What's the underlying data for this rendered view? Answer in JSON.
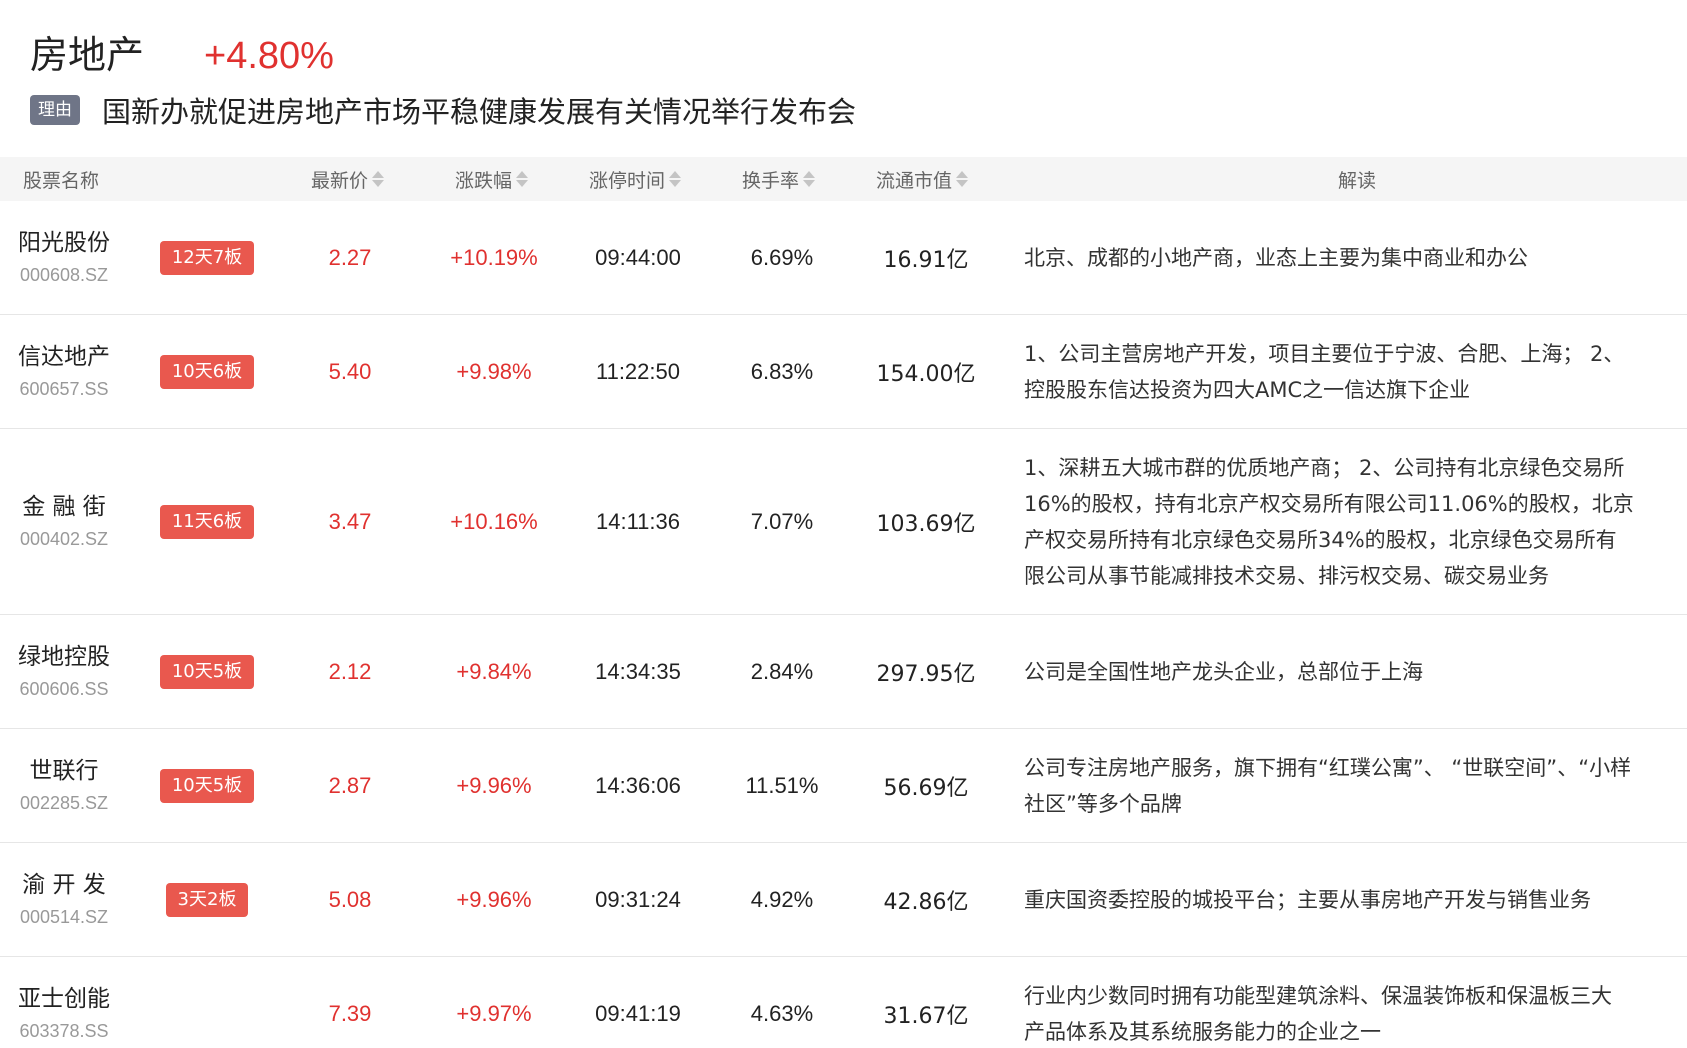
{
  "header": {
    "sector_name": "房地产",
    "sector_change": "+4.80%",
    "reason_tag": "理由",
    "reason_text": "国新办就促进房地产市场平稳健康发展有关情况举行发布会"
  },
  "columns": {
    "name": "股票名称",
    "price": "最新价",
    "change": "涨跌幅",
    "limit_time": "涨停时间",
    "turnover": "换手率",
    "market_cap": "流通市值",
    "note": "解读"
  },
  "rows": [
    {
      "name": "阳光股份",
      "code": "000608.SZ",
      "badge": "12天7板",
      "price": "2.27",
      "change": "+10.19%",
      "time": "09:44:00",
      "turnover": "6.69%",
      "cap": "16.91亿",
      "note": "北京、成都的小地产商，业态上主要为集中商业和办公"
    },
    {
      "name": "信达地产",
      "code": "600657.SS",
      "badge": "10天6板",
      "price": "5.40",
      "change": "+9.98%",
      "time": "11:22:50",
      "turnover": "6.83%",
      "cap": "154.00亿",
      "note": "1、公司主营房地产开发，项目主要位于宁波、合肥、上海； 2、\n控股股东信达投资为四大AMC之一信达旗下企业"
    },
    {
      "name": "金 融 街",
      "code": "000402.SZ",
      "badge": "11天6板",
      "price": "3.47",
      "change": "+10.16%",
      "time": "14:11:36",
      "turnover": "7.07%",
      "cap": "103.69亿",
      "note": "1、深耕五大城市群的优质地产商； 2、公司持有北京绿色交易所\n16%的股权，持有北京产权交易所有限公司11.06%的股权，北京\n产权交易所持有北京绿色交易所34%的股权，北京绿色交易所有\n限公司从事节能减排技术交易、排污权交易、碳交易业务"
    },
    {
      "name": "绿地控股",
      "code": "600606.SS",
      "badge": "10天5板",
      "price": "2.12",
      "change": "+9.84%",
      "time": "14:34:35",
      "turnover": "2.84%",
      "cap": "297.95亿",
      "note": "公司是全国性地产龙头企业，总部位于上海"
    },
    {
      "name": "世联行",
      "code": "002285.SZ",
      "badge": "10天5板",
      "price": "2.87",
      "change": "+9.96%",
      "time": "14:36:06",
      "turnover": "11.51%",
      "cap": "56.69亿",
      "note": "公司专注房地产服务，旗下拥有“红璞公寓”、 “世联空间”、“小样\n社区”等多个品牌"
    },
    {
      "name": "渝 开 发",
      "code": "000514.SZ",
      "badge": "3天2板",
      "price": "5.08",
      "change": "+9.96%",
      "time": "09:31:24",
      "turnover": "4.92%",
      "cap": "42.86亿",
      "note": "重庆国资委控股的城投平台；主要从事房地产开发与销售业务"
    },
    {
      "name": "亚士创能",
      "code": "603378.SS",
      "badge": "",
      "price": "7.39",
      "change": "+9.97%",
      "time": "09:41:19",
      "turnover": "4.63%",
      "cap": "31.67亿",
      "note": "行业内少数同时拥有功能型建筑涂料、保温装饰板和保温板三大\n产品体系及其系统服务能力的企业之一"
    }
  ]
}
